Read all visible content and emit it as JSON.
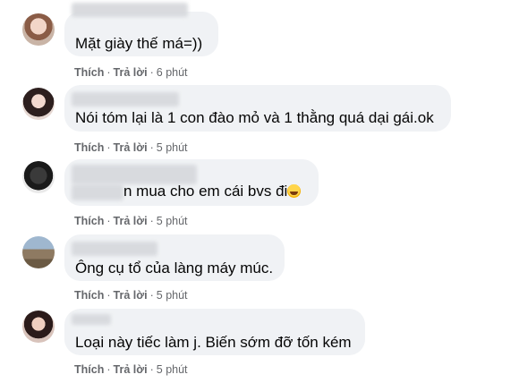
{
  "comments": [
    {
      "text": "Mặt giày thế má=))",
      "like": "Thích",
      "reply": "Trả lời",
      "time": "6 phút",
      "avatar_icon": "user-avatar-icon"
    },
    {
      "text": "Nói tóm lại là 1 con đào mỏ và 1 thằng quá dại gái.ok",
      "like": "Thích",
      "reply": "Trả lời",
      "time": "5 phút",
      "avatar_icon": "user-avatar-icon"
    },
    {
      "text": "n mua cho em cái bvs đi",
      "like": "Thích",
      "reply": "Trả lời",
      "time": "5 phút",
      "avatar_icon": "user-avatar-icon",
      "emoji_icon": "rofl-emoji-icon"
    },
    {
      "text": "Ông cụ tổ của làng máy múc.",
      "like": "Thích",
      "reply": "Trả lời",
      "time": "5 phút",
      "avatar_icon": "user-avatar-icon"
    },
    {
      "text": "Loại này tiếc làm j. Biến sớm đỡ tốn kém",
      "like": "Thích",
      "reply": "Trả lời",
      "time": "5 phút",
      "avatar_icon": "user-avatar-icon"
    }
  ],
  "separator": "·"
}
